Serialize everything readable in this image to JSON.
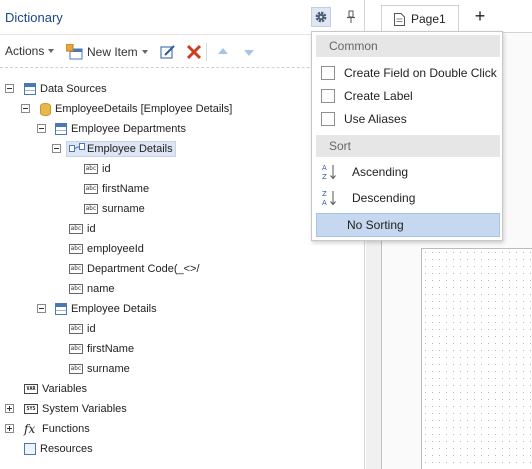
{
  "dictionary": {
    "title": "Dictionary",
    "toolbar": {
      "actions_label": "Actions",
      "new_item_label": "New Item"
    },
    "tree": {
      "data_sources": "Data Sources",
      "employee_details_source": "EmployeeDetails [Employee Details]",
      "employee_departments": "Employee Departments",
      "relation_employee_details": "Employee Details",
      "relation_fields": [
        "id",
        "firstName",
        "surname"
      ],
      "department_fields": [
        "id",
        "employeeId",
        "Department Code(_<>/",
        "name"
      ],
      "employee_details_table": "Employee Details",
      "employee_details_fields": [
        "id",
        "firstName",
        "surname"
      ],
      "variables": "Variables",
      "system_variables": "System Variables",
      "functions": "Functions",
      "resources": "Resources"
    }
  },
  "designer": {
    "tab_label": "Page1",
    "add_tab_label": "+"
  },
  "settings_menu": {
    "common_header": "Common",
    "create_field_label": "Create Field on Double Click",
    "create_label_label": "Create Label",
    "use_aliases_label": "Use Aliases",
    "sort_header": "Sort",
    "ascending_label": "Ascending",
    "descending_label": "Descending",
    "no_sorting_label": "No Sorting"
  },
  "icons": {
    "settings": "gear-icon",
    "pin": "pin-icon",
    "new_item": "new-item-icon",
    "edit": "edit-icon",
    "delete": "delete-icon",
    "move_up": "arrow-up-icon",
    "move_down": "arrow-down-icon"
  },
  "colors": {
    "title_blue": "#19478a",
    "selected_bg": "#c6d8ef",
    "delete_red": "#d23c1e"
  }
}
